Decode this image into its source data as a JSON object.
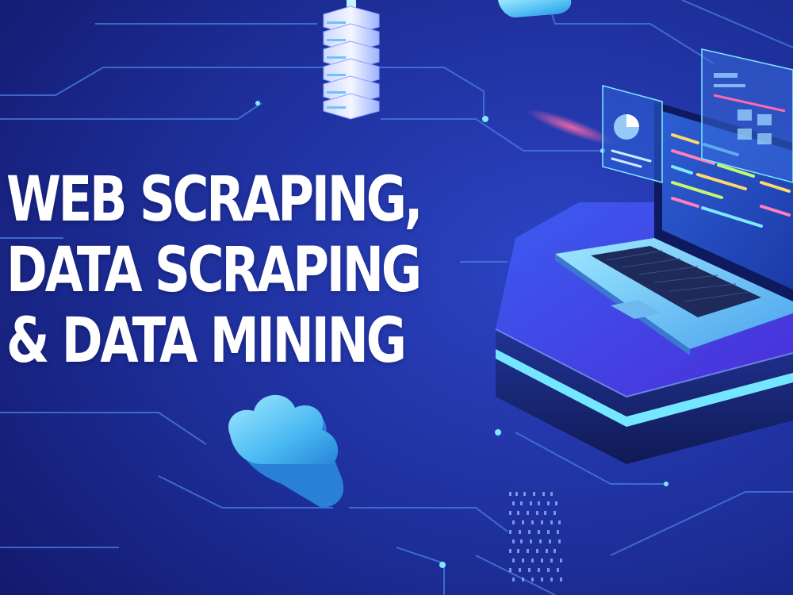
{
  "headline": {
    "line_1": "WEB SCRAPING,",
    "line_2": "DATA SCRAPING",
    "line_3": "& DATA MINING"
  },
  "colors": {
    "background_dark": "#141f7a",
    "background_light": "#2a3fb4",
    "circuit_line": "#4f86e6",
    "glow_cyan": "#5fe6ff",
    "platform_top": "#3a4ee0",
    "platform_side": "#1b2a66",
    "text": "#ffffff"
  },
  "icons": [
    "server-icon",
    "cloud-icon",
    "laptop-icon",
    "browser-window-icon",
    "code-window-icon",
    "binary-data-icon"
  ]
}
